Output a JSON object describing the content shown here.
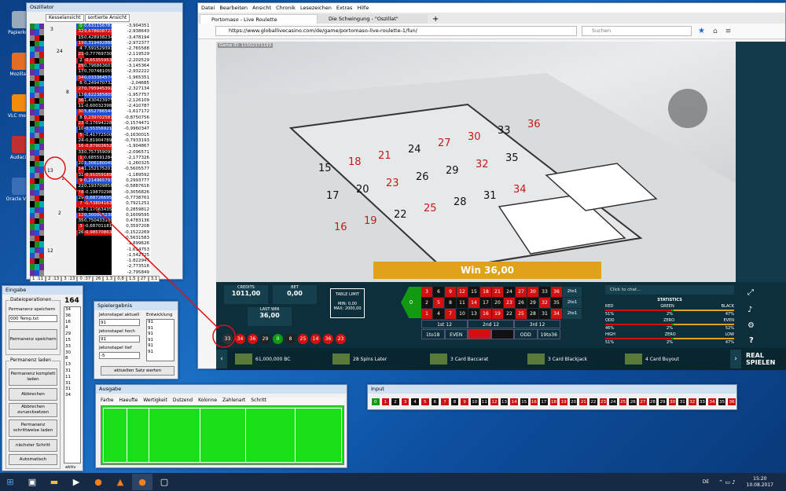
{
  "desktop": {
    "icons": [
      {
        "label": "Papierkorb"
      },
      {
        "label": "Mozilla Fi"
      },
      {
        "label": "VLC media"
      },
      {
        "label": "Audacity"
      },
      {
        "label": "Oracle VM V"
      }
    ]
  },
  "oszillator": {
    "title": "Oszillator",
    "tabs": [
      "Kesselansicht",
      "sortierte Ansicht"
    ],
    "rows": [
      {
        "n": "0",
        "v": "0,631156787893959",
        "c": "-3,904351"
      },
      {
        "n": "32",
        "v": "9,6786087230L367E-02",
        "c": "-2,938643"
      },
      {
        "n": "15",
        "v": "0,4289382342332575",
        "c": "-3,478194"
      },
      {
        "n": "19",
        "v": "0,3194928880077227",
        "c": "-2,972377"
      },
      {
        "n": "4",
        "v": "7,59152939173067E-02",
        "c": "-2,765588"
      },
      {
        "n": "21",
        "v": "-0,777697303717604",
        "c": "-2,119529"
      },
      {
        "n": "2",
        "v": "-0,653559538534061",
        "c": "-2,202529"
      },
      {
        "n": "25",
        "v": "0,7968636014953513",
        "c": "-3,145364"
      },
      {
        "n": "17",
        "v": "0,7074810592554122",
        "c": "-2,932222"
      },
      {
        "n": "34",
        "v": "0,03336457400754",
        "c": "-1,965351"
      },
      {
        "n": "6",
        "v": "0,249470732048214",
        "c": "-2,04685"
      },
      {
        "n": "27",
        "v": "0,7959453923689124",
        "c": "-2,327134"
      },
      {
        "n": "13",
        "v": "0,6223858090580991",
        "c": "-1,957757"
      },
      {
        "n": "36",
        "v": "1,43042397593311",
        "c": "-2,126109"
      },
      {
        "n": "11",
        "v": "-0,600323988028625",
        "c": "-2,410787"
      },
      {
        "n": "30",
        "v": "5,85278654469536E-02",
        "c": "-1,617172"
      },
      {
        "n": "8",
        "v": "0,2397025878997076",
        "c": "-0,8750756"
      },
      {
        "n": "23",
        "v": "-0,176942287516677",
        "c": "-0,1574471"
      },
      {
        "n": "10",
        "v": "-0,5535692110327394",
        "c": "-0,9960347"
      },
      {
        "n": "5",
        "v": "-0,4177250097574209",
        "c": "-0,1630015"
      },
      {
        "n": "24",
        "v": "-0,819047890042892",
        "c": "-0,7933193"
      },
      {
        "n": "16",
        "v": "-0,8790365274862787",
        "c": "-1,904867"
      },
      {
        "n": "33",
        "v": "0,7573590993698325",
        "c": "-2,096571"
      },
      {
        "n": "1",
        "v": "0,685591284327664",
        "c": "-2,177326"
      },
      {
        "n": "20",
        "v": "1,306180049840823",
        "c": "-1,260325"
      },
      {
        "n": "14",
        "v": "1,152175207526395",
        "c": "-0,5605577"
      },
      {
        "n": "31",
        "v": "-0,910591894451624",
        "c": "-1,189592"
      },
      {
        "n": "9",
        "v": "0,2149657937818677",
        "c": "0,2993777"
      },
      {
        "n": "22",
        "v": "0,1937098562048045",
        "c": "-0,5887616"
      },
      {
        "n": "18",
        "v": "-0,1987029854511795",
        "c": "-0,3056826"
      },
      {
        "n": "29",
        "v": "-0,6872669509817169",
        "c": "-0,7738761"
      },
      {
        "n": "7",
        "v": "-0,538041636349818",
        "c": "0,7921251"
      },
      {
        "n": "28",
        "v": "-0,170634356484296",
        "c": "0,2859812"
      },
      {
        "n": "12",
        "v": "0,3000652388605903",
        "c": "0,1609595"
      },
      {
        "n": "35",
        "v": "0,7504331302020723",
        "c": "0,4783136"
      },
      {
        "n": "3",
        "v": "-0,687011811880526",
        "c": "0,3597208"
      },
      {
        "n": "26",
        "v": "-0,9857086322700023",
        "c": "-0,1522269"
      }
    ],
    "extra": [
      "-0,5631583",
      "-1,899626",
      "-1,614753",
      "-1,542725",
      "-1,822947",
      "-2,773516",
      "-2,795849",
      "-1,904481",
      "-3,341763"
    ],
    "left_nums": [
      "3",
      "24",
      "8",
      "13",
      "1",
      "2",
      "12"
    ],
    "alle": "ALLE",
    "bottom": [
      "1 :11",
      "2 :13",
      "3 :13",
      "0 :37",
      "26",
      "1,3",
      "0,8",
      "1,5",
      "27",
      "3,1"
    ]
  },
  "eingabe": {
    "title": "Eingabe",
    "group1": "Dateioperationen",
    "perm_label": "Permanenz speichern",
    "file": "000 Temp.txt",
    "btn_save": "Permanenz speichern",
    "group2": "Permanenz laden",
    "btn_load_all": "Permanenz komplett laden",
    "btn_cancel": "Abbrechen",
    "btn_cancel_reset": "Abbrechen zuruecksetzen",
    "btn_stepwise": "Permanenz schrittweise laden",
    "btn_next": "nächster Schritt",
    "btn_auto": "Automatisch",
    "count": "164",
    "list": [
      "34",
      "36",
      "16",
      "4",
      "29",
      "15",
      "33",
      "30",
      "8",
      "13",
      "31",
      "11",
      "31",
      "31",
      "34"
    ],
    "aktiv": "aktiv"
  },
  "spieler": {
    "title": "Spielergebnis",
    "label1": "Jetonstapel aktuell",
    "val1": "91",
    "label2": "Jetonstapel hoch",
    "val2": "91",
    "label3": "Jetonstapel tief",
    "val3": "-5",
    "label4": "Entwicklung",
    "list": [
      "91",
      "91",
      "91",
      "91",
      "91",
      "91"
    ],
    "btn": "aktuellen Satz werten"
  },
  "ausgabe": {
    "title": "Ausgabe",
    "headers": [
      "Farbe",
      "Haeufte",
      "Wertigkeit",
      "Dutzend",
      "Kolonne",
      "Zahlenart",
      "Schritt"
    ]
  },
  "input": {
    "title": "Input",
    "numbers": [
      "0",
      "1",
      "2",
      "3",
      "4",
      "5",
      "6",
      "7",
      "8",
      "9",
      "10",
      "11",
      "12",
      "13",
      "14",
      "15",
      "16",
      "17",
      "18",
      "19",
      "20",
      "21",
      "22",
      "23",
      "24",
      "25",
      "26",
      "27",
      "28",
      "29",
      "30",
      "31",
      "32",
      "33",
      "34",
      "35",
      "36"
    ]
  },
  "browser": {
    "menu": [
      "Datei",
      "Bearbeiten",
      "Ansicht",
      "Chronik",
      "Lesezeichen",
      "Extras",
      "Hilfe"
    ],
    "tab1": "Portomaso - Live Roulette",
    "tab2": "Die Schwingung - \"Oszillat\"",
    "url": "https://www.globallivecasino.com/de/game/portomaso-live-roulette-1/fun/",
    "search": "Suchen"
  },
  "game": {
    "id": "Game ID: 11502371193",
    "win": "Win 36,00",
    "credits_label": "CREDITS",
    "credits": "1011,00",
    "bet_label": "BET",
    "bet": "0,00",
    "lastwin_label": "LAST WIN",
    "lastwin": "36,00",
    "limit_title": "TABLE LIMIT",
    "limit_min": "MIN: 0,00",
    "limit_max": "MAX: 2000,00",
    "history": [
      {
        "n": "33",
        "c": "#333"
      },
      {
        "n": "34",
        "c": "#d21010"
      },
      {
        "n": "36",
        "c": "#d21010"
      },
      {
        "n": "29",
        "c": "#222"
      },
      {
        "n": "0",
        "c": "#129a12"
      },
      {
        "n": "8",
        "c": "#222"
      },
      {
        "n": "25",
        "c": "#d21010"
      },
      {
        "n": "14",
        "c": "#d21010"
      },
      {
        "n": "36",
        "c": "#d21010"
      },
      {
        "n": "23",
        "c": "#d21010"
      }
    ],
    "bettable": {
      "zero": "0",
      "rows": [
        [
          "3",
          "6",
          "9",
          "12",
          "15",
          "18",
          "21",
          "24",
          "27",
          "30",
          "33",
          "36"
        ],
        [
          "2",
          "5",
          "8",
          "11",
          "14",
          "17",
          "20",
          "23",
          "26",
          "29",
          "32",
          "35"
        ],
        [
          "1",
          "4",
          "7",
          "10",
          "13",
          "16",
          "19",
          "22",
          "25",
          "28",
          "31",
          "34"
        ]
      ],
      "col": "2to1",
      "dozens": [
        "1st 12",
        "2nd 12",
        "3rd 12"
      ],
      "outside": [
        "1to18",
        "EVEN",
        "",
        "",
        "ODD",
        "19to36"
      ]
    },
    "chat": "Click to chat...",
    "stats_title": "STATISTICS",
    "stats": [
      {
        "l": "RED",
        "m": "GREEN",
        "r": "BLACK",
        "lv": "51%",
        "mv": "2%",
        "rv": "47%"
      },
      {
        "l": "ODD",
        "m": "ZERO",
        "r": "EVEN",
        "lv": "46%",
        "mv": "2%",
        "rv": "52%"
      },
      {
        "l": "HIGH",
        "m": "ZERO",
        "r": "LOW",
        "lv": "51%",
        "mv": "2%",
        "rv": "47%"
      }
    ],
    "bar": [
      {
        "t": "61,000,000 BC"
      },
      {
        "t": "28 Spins Later"
      },
      {
        "t": "3 Card Baccarat"
      },
      {
        "t": "3 Card Blackjack"
      },
      {
        "t": "4 Card Buyout"
      }
    ],
    "play": "REAL SPIELEN"
  },
  "taskbar": {
    "lang": "DE",
    "time": "15:20",
    "date": "10.08.2017"
  }
}
